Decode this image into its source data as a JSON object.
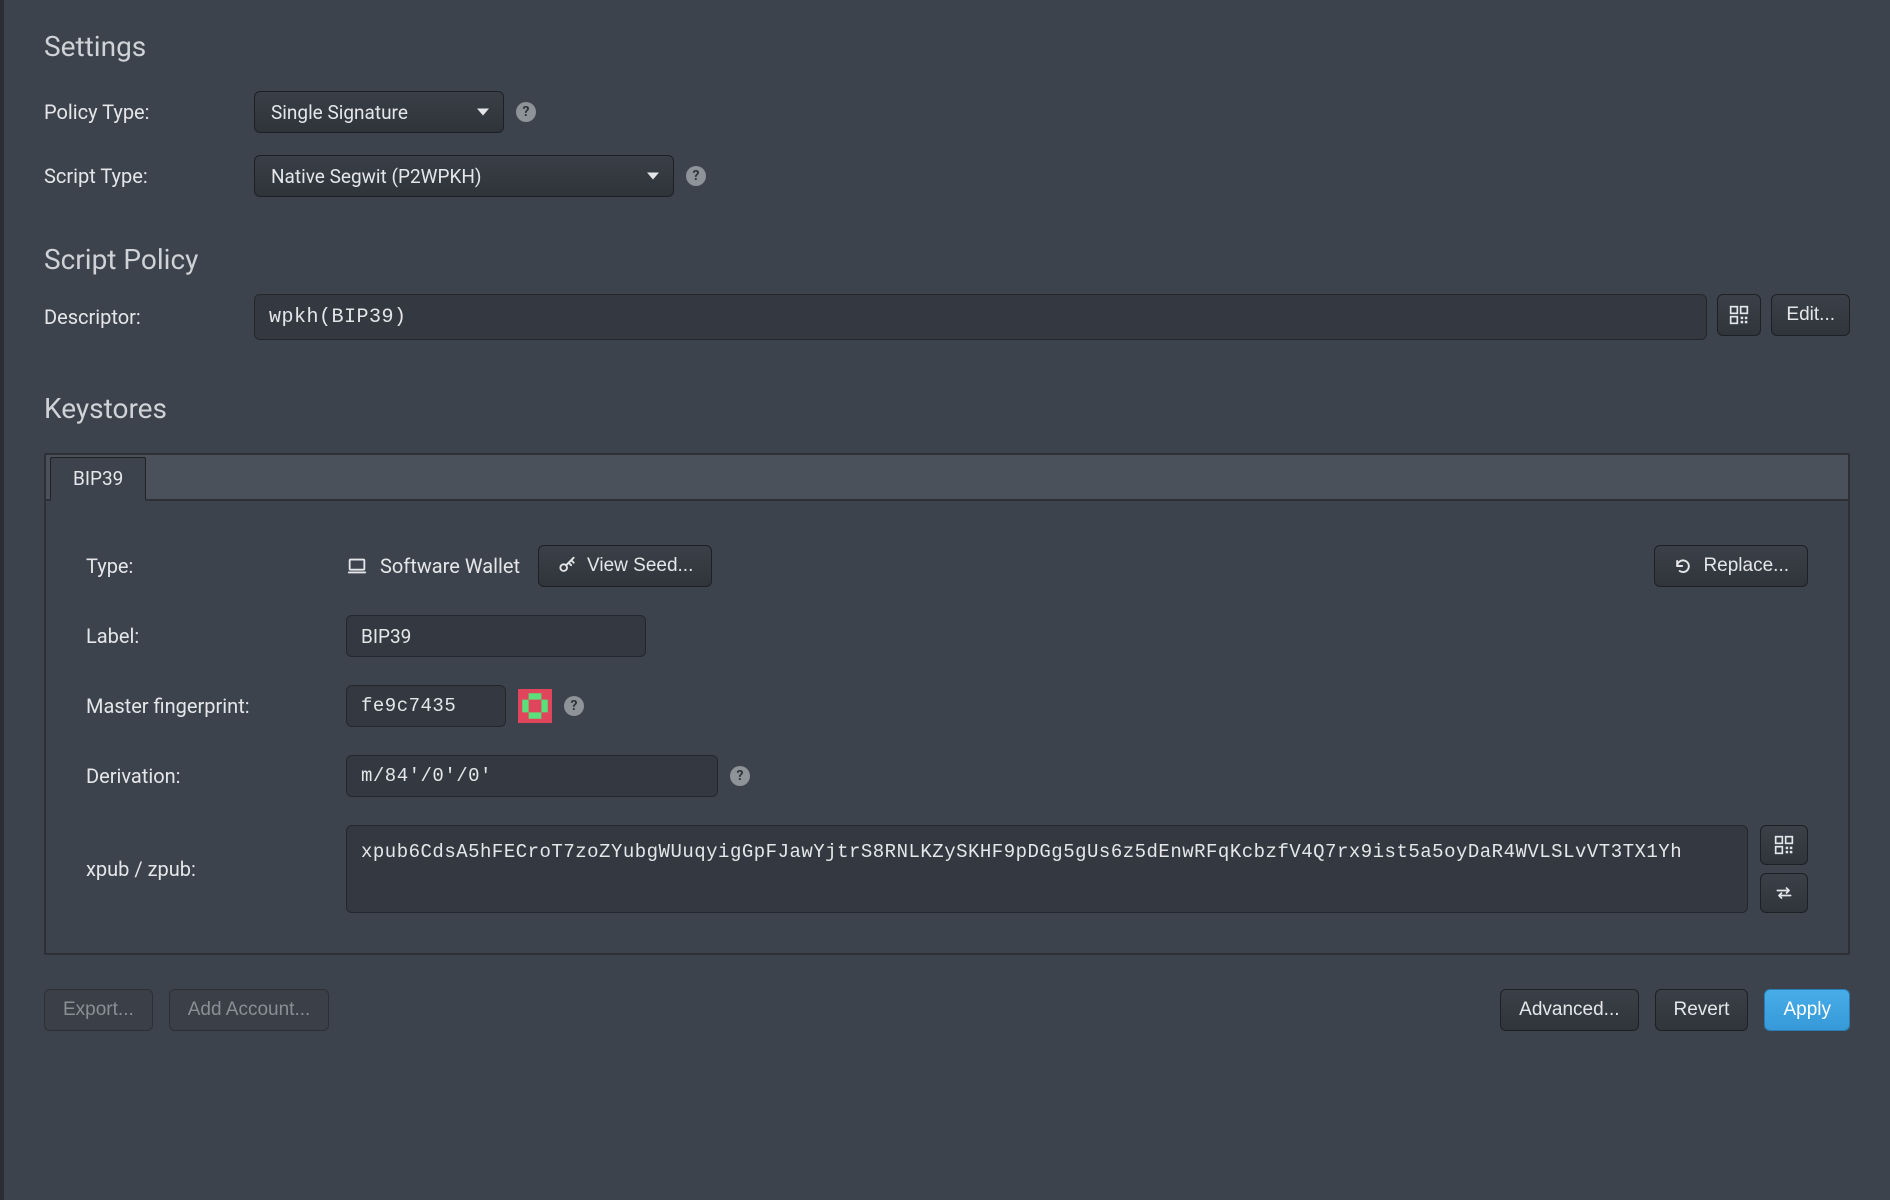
{
  "settings": {
    "heading": "Settings",
    "policy_type_label": "Policy Type:",
    "policy_type_value": "Single Signature",
    "script_type_label": "Script Type:",
    "script_type_value": "Native Segwit (P2WPKH)"
  },
  "script_policy": {
    "heading": "Script Policy",
    "descriptor_label": "Descriptor:",
    "descriptor_value": "wpkh(BIP39)",
    "edit_label": "Edit..."
  },
  "keystores": {
    "heading": "Keystores",
    "tabs": [
      {
        "label": "BIP39"
      }
    ],
    "type_label": "Type:",
    "type_value": "Software Wallet",
    "view_seed_label": "View Seed...",
    "replace_label": "Replace...",
    "label_label": "Label:",
    "label_value": "BIP39",
    "fingerprint_label": "Master fingerprint:",
    "fingerprint_value": "fe9c7435",
    "derivation_label": "Derivation:",
    "derivation_value": "m/84'/0'/0'",
    "xpub_label": "xpub / zpub:",
    "xpub_value": "xpub6CdsA5hFECroT7zoZYubgWUuqyigGpFJawYjtrS8RNLKZySKHF9pDGg5gUs6z5dEnwRFqKcbzfV4Q7rx9ist5a5oyDaR4WVLSLvVT3TX1Yh"
  },
  "footer": {
    "export_label": "Export...",
    "add_account_label": "Add Account...",
    "advanced_label": "Advanced...",
    "revert_label": "Revert",
    "apply_label": "Apply"
  }
}
